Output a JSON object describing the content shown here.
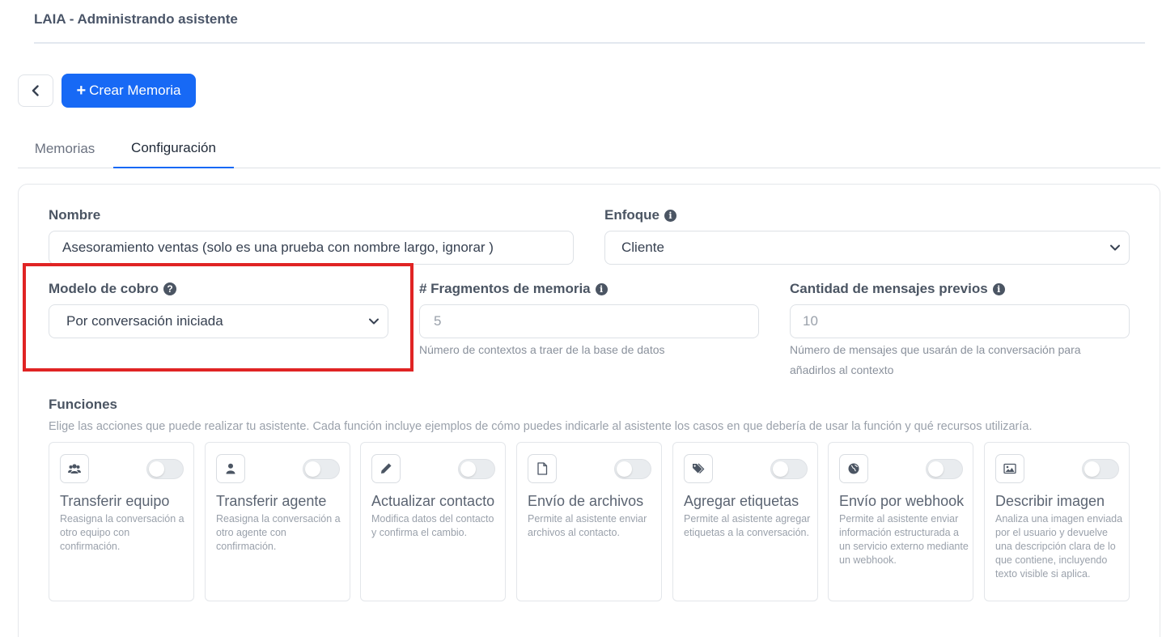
{
  "header": {
    "title": "LAIA - Administrando asistente"
  },
  "toolbar": {
    "create_label": "Crear Memoria"
  },
  "tabs": [
    {
      "label": "Memorias",
      "active": false
    },
    {
      "label": "Configuración",
      "active": true
    }
  ],
  "form": {
    "nombre": {
      "label": "Nombre",
      "value": "Asesoramiento ventas (solo es una prueba con nombre largo, ignorar )"
    },
    "enfoque": {
      "label": "Enfoque",
      "value": "Cliente"
    },
    "modelo_cobro": {
      "label": "Modelo de cobro",
      "value": "Por conversación iniciada"
    },
    "fragmentos": {
      "label": "# Fragmentos de memoria",
      "value": "5",
      "help": "Número de contextos a traer de la base de datos"
    },
    "mensajes": {
      "label": "Cantidad de mensajes previos",
      "value": "10",
      "help_1": "Número de mensajes que usarán de la conversación para",
      "help_2": "añadirlos al contexto"
    }
  },
  "funciones": {
    "title": "Funciones",
    "description": "Elige las acciones que puede realizar tu asistente. Cada función incluye ejemplos de cómo puedes indicarle al asistente los casos en que debería de usar la función y qué recursos utilizaría.",
    "items": [
      {
        "name": "Transferir equipo",
        "description": "Reasigna la conversación a otro equipo con confirmación.",
        "icon": "users-icon",
        "enabled": false
      },
      {
        "name": "Transferir agente",
        "description": "Reasigna la conversación a otro agente con confirmación.",
        "icon": "user-icon",
        "enabled": false
      },
      {
        "name": "Actualizar contacto",
        "description": "Modifica datos del contacto y confirma el cambio.",
        "icon": "pencil-icon",
        "enabled": false
      },
      {
        "name": "Envío de archivos",
        "description": "Permite al asistente enviar archivos al contacto.",
        "icon": "file-icon",
        "enabled": false
      },
      {
        "name": "Agregar etiquetas",
        "description": "Permite al asistente agregar etiquetas a la conversación.",
        "icon": "tags-icon",
        "enabled": false
      },
      {
        "name": "Envío por webhook",
        "description": "Permite al asistente enviar información estructurada a un servicio externo mediante un webhook.",
        "icon": "globe-icon",
        "enabled": false
      },
      {
        "name": "Describir imagen",
        "description": "Analiza una imagen enviada por el usuario y devuelve una descripción clara de lo que contiene, incluyendo texto visible si aplica.",
        "icon": "image-icon",
        "enabled": false
      }
    ]
  },
  "colors": {
    "accent": "#1769f5",
    "highlight": "#e02424"
  }
}
